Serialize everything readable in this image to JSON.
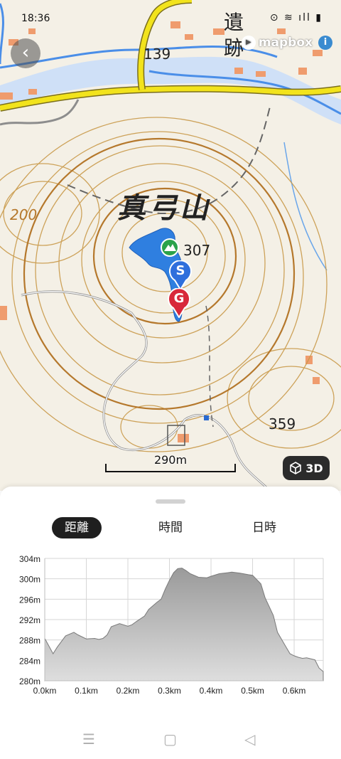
{
  "status_bar": {
    "time": "18:36",
    "icons": "⊙ ≋ ıll ▮"
  },
  "map": {
    "attribution": "mapbox",
    "peak_name": "真弓山",
    "labels": {
      "elev_307": "307",
      "elev_139": "139",
      "elev_359": "359",
      "contour_200": "200",
      "ruin": "遺",
      "ruin2": "跡"
    },
    "scale_label": "290m",
    "btn_3d_label": "3D",
    "start_marker": "S",
    "goal_marker": "G",
    "colors": {
      "route": "#2f7fe0",
      "road_yellow": "#f2e31c",
      "river": "#4a8ee8",
      "contour": "#c99a4a"
    }
  },
  "tabs": [
    {
      "label": "距離",
      "active": true
    },
    {
      "label": "時間",
      "active": false
    },
    {
      "label": "日時",
      "active": false
    }
  ],
  "chart_data": {
    "type": "area",
    "title": "",
    "xlabel": "",
    "ylabel": "",
    "xlim": [
      0,
      0.67
    ],
    "ylim": [
      280,
      304
    ],
    "x_ticks": [
      "0.0km",
      "0.1km",
      "0.2km",
      "0.3km",
      "0.4km",
      "0.5km",
      "0.6km"
    ],
    "y_ticks": [
      "304m",
      "300m",
      "296m",
      "292m",
      "288m",
      "284m",
      "280m"
    ],
    "x": [
      0.0,
      0.01,
      0.02,
      0.03,
      0.05,
      0.07,
      0.08,
      0.1,
      0.12,
      0.13,
      0.14,
      0.15,
      0.16,
      0.18,
      0.2,
      0.21,
      0.22,
      0.24,
      0.25,
      0.27,
      0.28,
      0.29,
      0.3,
      0.31,
      0.32,
      0.33,
      0.34,
      0.35,
      0.37,
      0.39,
      0.4,
      0.42,
      0.44,
      0.45,
      0.47,
      0.49,
      0.5,
      0.52,
      0.53,
      0.55,
      0.56,
      0.58,
      0.59,
      0.6,
      0.61,
      0.62,
      0.63,
      0.65,
      0.66,
      0.67
    ],
    "y": [
      288.3,
      286.8,
      285.3,
      286.6,
      288.8,
      289.5,
      289.0,
      288.2,
      288.3,
      288.1,
      288.3,
      289.0,
      290.6,
      291.2,
      290.7,
      291.0,
      291.6,
      292.7,
      294.0,
      295.4,
      296.0,
      298.0,
      299.7,
      301.2,
      302.0,
      302.1,
      301.6,
      301.0,
      300.3,
      300.2,
      300.5,
      301.0,
      301.2,
      301.3,
      301.1,
      300.8,
      300.7,
      299.0,
      296.3,
      292.8,
      289.5,
      286.7,
      285.3,
      284.9,
      284.6,
      284.4,
      284.5,
      284.1,
      282.5,
      281.8
    ],
    "grid": true,
    "fill_color": "#9a9a9a"
  }
}
